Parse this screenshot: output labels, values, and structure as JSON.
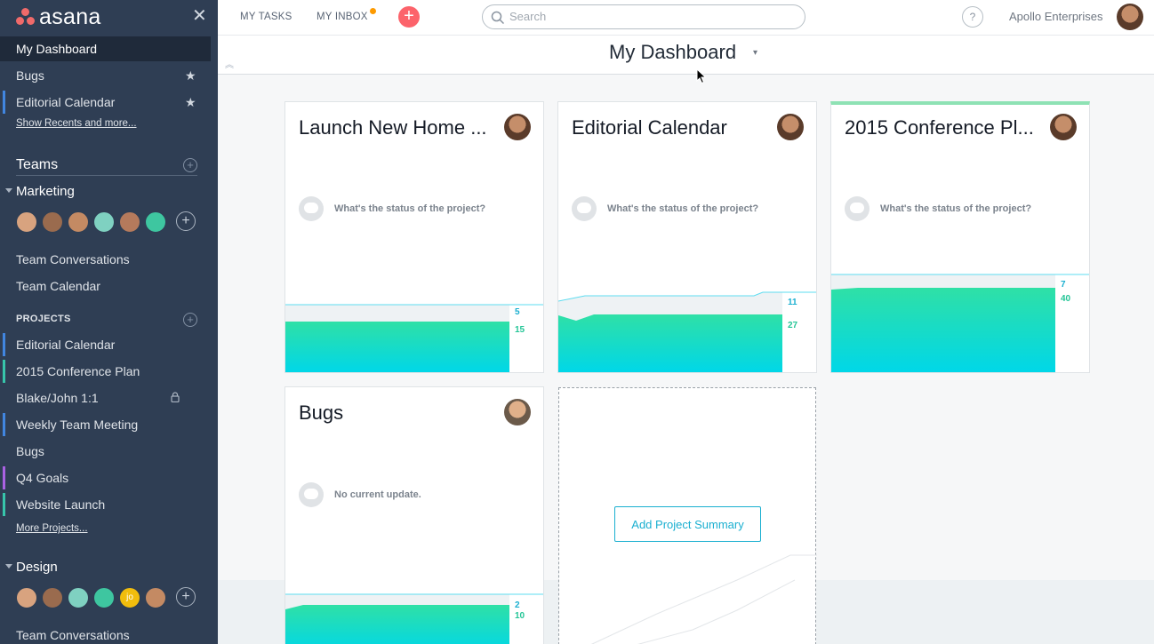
{
  "sidebar": {
    "logo_text": "asana",
    "items_top": [
      {
        "label": "My Dashboard",
        "active": true
      },
      {
        "label": "Bugs",
        "starred": true
      },
      {
        "label": "Editorial Calendar",
        "starred": true,
        "color": "#4186e0"
      }
    ],
    "show_recents": "Show Recents and more...",
    "teams_label": "Teams",
    "marketing": {
      "name": "Marketing",
      "avatars": [
        "#d8a37f",
        "#9a6b4e",
        "#c48a63",
        "#7fd1c1",
        "#b57a5c",
        "#3ec6a0"
      ],
      "links": [
        "Team Conversations",
        "Team Calendar"
      ]
    },
    "projects_label": "PROJECTS",
    "projects": [
      {
        "label": "Editorial Calendar",
        "color": "#4186e0"
      },
      {
        "label": "2015 Conference Plan",
        "color": "#37c5ab"
      },
      {
        "label": "Blake/John 1:1",
        "locked": true
      },
      {
        "label": "Weekly Team Meeting",
        "color": "#4186e0"
      },
      {
        "label": "Bugs"
      },
      {
        "label": "Q4 Goals",
        "color": "#aa62e3"
      },
      {
        "label": "Website Launch",
        "color": "#37c5ab"
      }
    ],
    "more_projects": "More Projects...",
    "design": {
      "name": "Design",
      "avatars": [
        "#d8a37f",
        "#9a6b4e",
        "#7fd1c1",
        "#3ec6a0",
        "#f1bd0d",
        "#c48a63"
      ],
      "avatar_initials": "jo",
      "links": [
        "Team Conversations"
      ]
    }
  },
  "topbar": {
    "my_tasks": "MY TASKS",
    "my_inbox": "MY INBOX",
    "search_placeholder": "Search",
    "help": "?",
    "org_name": "Apollo Enterprises"
  },
  "header": {
    "title": "My Dashboard"
  },
  "cards": [
    {
      "title": "Launch New Home ...",
      "status": "What's the status of the project?",
      "remaining": "5",
      "completed": "15"
    },
    {
      "title": "Editorial Calendar",
      "status": "What's the status of the project?",
      "remaining": "11",
      "completed": "27"
    },
    {
      "title": "2015 Conference Pl...",
      "status": "What's the status of the project?",
      "remaining": "7",
      "completed": "40"
    },
    {
      "title": "Bugs",
      "status": "No current update.",
      "remaining": "2",
      "completed": "10"
    }
  ],
  "add_summary_label": "Add Project Summary",
  "colors": {
    "sidebar": "#2f3e54",
    "accent": "#1aafd0",
    "green": "#24c596",
    "quick_add": "#fc636b"
  }
}
